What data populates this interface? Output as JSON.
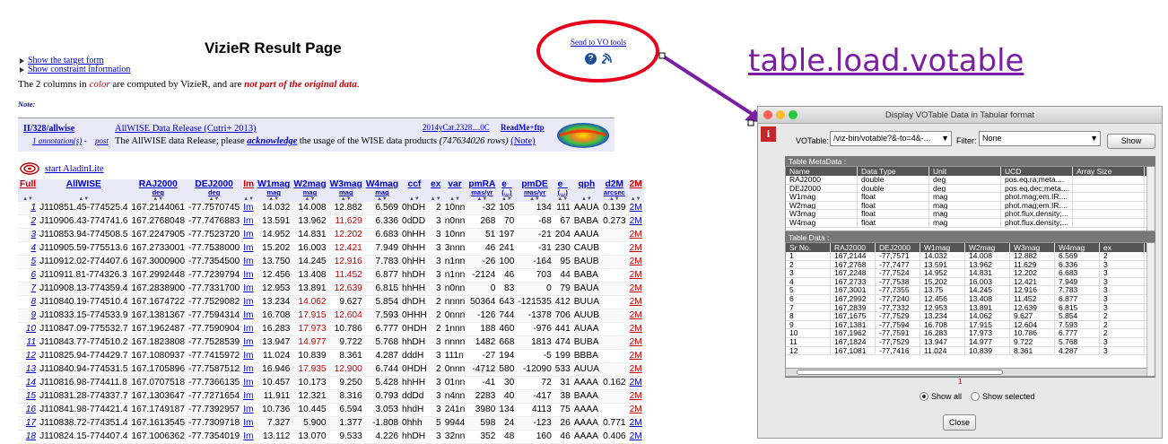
{
  "page": {
    "title": "VizieR Result Page",
    "links": [
      "Show the target form",
      "Show constraint information"
    ],
    "columns_note_prefix": "The 2 columns in ",
    "columns_note_color": "color",
    "columns_note_mid": " are computed by VizieR, and are ",
    "columns_note_not": "not part of the original data",
    "columns_note_suffix": ".",
    "note_label": "Note:",
    "send_vo": "Send to VO tools",
    "aladin": "start AladinLite"
  },
  "catalog": {
    "id": "II/328/allwise",
    "annotation": "1 annotation(s)",
    "annotation_sep": " - ",
    "post": "post",
    "name": "AllWISE Data Release (Cutri+ 2013)",
    "desc_prefix": "The AllWISE data Release; please ",
    "desc_ack": "acknowledge",
    "desc_mid": " the usage of the WISE data products ",
    "desc_rows": "(747634026 rows)",
    "desc_note": "(Note)",
    "ref": "2014yCat.2328....0C",
    "readme": "ReadMe+ftp"
  },
  "results": {
    "headers": [
      {
        "label": "Full",
        "unit": "",
        "red": true
      },
      {
        "label": "AllWISE",
        "unit": "",
        "red": false
      },
      {
        "label": "RAJ2000",
        "unit": "deg",
        "red": false
      },
      {
        "label": "DEJ2000",
        "unit": "deg",
        "red": false
      },
      {
        "label": "Im",
        "unit": "",
        "red": true
      },
      {
        "label": "W1mag",
        "unit": "mag",
        "red": false
      },
      {
        "label": "W2mag",
        "unit": "mag",
        "red": false
      },
      {
        "label": "W3mag",
        "unit": "mag",
        "red": false
      },
      {
        "label": "W4mag",
        "unit": "mag",
        "red": false
      },
      {
        "label": "ccf",
        "unit": "",
        "red": false
      },
      {
        "label": "ex",
        "unit": "",
        "red": false
      },
      {
        "label": "var",
        "unit": "",
        "red": false
      },
      {
        "label": "pmRA",
        "unit": "mas/yr",
        "red": false
      },
      {
        "label": "e_",
        "unit": "(...)",
        "red": false
      },
      {
        "label": "pmDE",
        "unit": "mas/yr",
        "red": false
      },
      {
        "label": "e_",
        "unit": "(...)",
        "red": false
      },
      {
        "label": "qph",
        "unit": "",
        "red": false
      },
      {
        "label": "d2M",
        "unit": "arcsec",
        "red": false
      },
      {
        "label": "2M",
        "unit": "",
        "red": true
      }
    ],
    "sort_glyph": "▲▼",
    "rows": [
      [
        "1",
        "J110851.45-774525.4",
        "167.2144061",
        "-77.7570745",
        "Im",
        "14.032",
        "14.008",
        "12.882",
        "6.569",
        "0hDH",
        "2",
        "10nn",
        "-32",
        "105",
        "134",
        "111",
        "AAUA",
        "0.139",
        "2M"
      ],
      [
        "2",
        "J110906.43-774741.6",
        "167.2768048",
        "-77.7476883",
        "Im",
        "13.591",
        "13.962",
        "11.629",
        "6.336",
        "0dDD",
        "3",
        "n0nn",
        "268",
        "70",
        "-68",
        "67",
        "BABA",
        "0.273",
        "2M"
      ],
      [
        "3",
        "J110853.94-774508.5",
        "167.2247905",
        "-77.7523720",
        "Im",
        "14.952",
        "14.831",
        "12.202",
        "6.683",
        "0hHH",
        "3",
        "10nn",
        "51",
        "197",
        "-21",
        "204",
        "AAUA",
        "",
        "2M"
      ],
      [
        "4",
        "J110905.59-775513.6",
        "167.2733001",
        "-77.7538000",
        "Im",
        "15.202",
        "16.003",
        "12.421",
        "7.949",
        "0hHH",
        "3",
        "3nnn",
        "46",
        "241",
        "-31",
        "230",
        "CAUB",
        "",
        "2M"
      ],
      [
        "5",
        "J110912.02-774407.6",
        "167.3000900",
        "-77.7354500",
        "Im",
        "13.750",
        "14.245",
        "12.916",
        "7.783",
        "0hHH",
        "3",
        "n1nn",
        "-26",
        "100",
        "-164",
        "95",
        "BAUB",
        "",
        "2M"
      ],
      [
        "6",
        "J110911.81-774326.3",
        "167.2992448",
        "-77.7239794",
        "Im",
        "12.456",
        "13.408",
        "11.452",
        "6.877",
        "hhDH",
        "3",
        "n1nn",
        "-2124",
        "46",
        "703",
        "44",
        "BABA",
        "",
        "2M"
      ],
      [
        "7",
        "J110908.13-774359.4",
        "167.2838900",
        "-77.7331700",
        "Im",
        "12.953",
        "13.891",
        "12.639",
        "6.815",
        "hhHH",
        "3",
        "n0nn",
        "0",
        "83",
        "0",
        "79",
        "BAUA",
        "",
        "2M"
      ],
      [
        "8",
        "J110840.19-774510.4",
        "167.1674722",
        "-77.7529082",
        "Im",
        "13.234",
        "14.062",
        "9.627",
        "5.854",
        "dhDH",
        "2",
        "nnnn",
        "50364",
        "643",
        "-121535",
        "412",
        "BUUA",
        "",
        "2M"
      ],
      [
        "9",
        "J110833.15-774533.9",
        "167.1381367",
        "-77.7594314",
        "Im",
        "16.708",
        "17.915",
        "12.604",
        "7.593",
        "0HHH",
        "2",
        "0nnn",
        "-126",
        "744",
        "-1378",
        "706",
        "AUUB",
        "",
        "2M"
      ],
      [
        "10",
        "J110847.09-775532.7",
        "167.1962487",
        "-77.7590904",
        "Im",
        "16.283",
        "17.973",
        "10.786",
        "6.777",
        "0HDH",
        "2",
        "1nnn",
        "188",
        "460",
        "-976",
        "441",
        "AUAA",
        "",
        "2M"
      ],
      [
        "11",
        "J110843.77-774510.2",
        "167.1823808",
        "-77.7528539",
        "Im",
        "13.947",
        "14.977",
        "9.722",
        "5.768",
        "hhDH",
        "3",
        "nnnn",
        "1482",
        "668",
        "1813",
        "474",
        "BUBA",
        "",
        "2M"
      ],
      [
        "12",
        "J110825.94-774429.7",
        "167.1080937",
        "-77.7415972",
        "Im",
        "11.024",
        "10.839",
        "8.361",
        "4.287",
        "dddH",
        "3",
        "111n",
        "-27",
        "194",
        "-5",
        "199",
        "BBBA",
        "",
        "2M"
      ],
      [
        "13",
        "J110840.94-774531.5",
        "167.1705896",
        "-77.7587512",
        "Im",
        "16.946",
        "17.935",
        "12.900",
        "6.744",
        "0HDH",
        "2",
        "0nnn",
        "-4712",
        "580",
        "-12090",
        "533",
        "AUUA",
        "",
        "2M"
      ],
      [
        "14",
        "J110816.98-774411.8",
        "167.0707518",
        "-77.7366135",
        "Im",
        "10.457",
        "10.173",
        "9.250",
        "5.428",
        "hhHH",
        "3",
        "01nn",
        "-41",
        "30",
        "72",
        "31",
        "AAAA",
        "0.162",
        "2M"
      ],
      [
        "15",
        "J110831.28-774337.7",
        "167.1303647",
        "-77.7271654",
        "Im",
        "11.911",
        "12.321",
        "8.316",
        "0.793",
        "ddDd",
        "3",
        "n4nn",
        "2283",
        "40",
        "-417",
        "38",
        "BAAA",
        "",
        "2M"
      ],
      [
        "16",
        "J110841.98-774421.4",
        "167.1749187",
        "-77.7392957",
        "Im",
        "10.736",
        "10.445",
        "6.594",
        "3.053",
        "hhdH",
        "3",
        "241n",
        "3980",
        "134",
        "4113",
        "75",
        "AAAA",
        "",
        "2M"
      ],
      [
        "17",
        "J110838.72-774351.4",
        "167.1613545",
        "-77.7309718",
        "Im",
        "7.327",
        "5.900",
        "1.377",
        "-1.808",
        "0hhh",
        "5",
        "9944",
        "598",
        "24",
        "-123",
        "26",
        "AAAA",
        "0.771",
        "2M"
      ],
      [
        "18",
        "J110824.15-774407.4",
        "167.1006362",
        "-77.7354019",
        "Im",
        "13.112",
        "13.070",
        "9.533",
        "4.226",
        "hhDH",
        "3",
        "32nn",
        "352",
        "48",
        "160",
        "46",
        "AAAA",
        "0.406",
        "2M"
      ]
    ]
  },
  "annotation": {
    "command": "table.load.votable"
  },
  "window": {
    "title": "Display VOTable Data in Tabular format",
    "info_icon": "i",
    "votable_label": "VOTable:",
    "votable_value": "/viz-bin/votable?&-to=4&-...",
    "filter_label": "Filter:",
    "filter_value": "None",
    "show_button": "Show",
    "meta_title": "Table MetaData :",
    "meta_headers": [
      "Name",
      "Data Type",
      "Unit",
      "UCD",
      "Array Size"
    ],
    "meta_rows": [
      [
        "RAJ2000",
        "double",
        "deg",
        "pos.eq.ra;meta....",
        ""
      ],
      [
        "DEJ2000",
        "double",
        "deg",
        "pos.eq.dec;meta....",
        ""
      ],
      [
        "W1mag",
        "float",
        "mag",
        "phot.mag;em.IR....",
        ""
      ],
      [
        "W2mag",
        "float",
        "mag",
        "phot.mag;em.IR....",
        ""
      ],
      [
        "W3mag",
        "float",
        "mag",
        "phot.flux.density;...",
        ""
      ],
      [
        "W4mag",
        "float",
        "mag",
        "phot.flux.density;...",
        ""
      ]
    ],
    "data_title": "Table Data :",
    "data_headers": [
      "Sr No.",
      "RAJ2000",
      "DEJ2000",
      "W1mag",
      "W2mag",
      "W3mag",
      "W4mag",
      "ex"
    ],
    "data_rows": [
      [
        "1",
        "167,2144",
        "-77,7571",
        "14.032",
        "14.008",
        "12.882",
        "6.569",
        "2"
      ],
      [
        "2",
        "167,2768",
        "-77,7477",
        "13.591",
        "13.962",
        "11.629",
        "6.336",
        "3"
      ],
      [
        "3",
        "167,2248",
        "-77,7524",
        "14.952",
        "14.831",
        "12.202",
        "6.683",
        "3"
      ],
      [
        "4",
        "167,2733",
        "-77,7538",
        "15.202",
        "16.003",
        "12.421",
        "7.949",
        "3"
      ],
      [
        "5",
        "167,3001",
        "-77,7355",
        "13.75",
        "14.245",
        "12.916",
        "7.783",
        "3"
      ],
      [
        "6",
        "167,2992",
        "-77,7240",
        "12.456",
        "13.408",
        "11.452",
        "6.877",
        "3"
      ],
      [
        "7",
        "167,2839",
        "-77,7332",
        "12.953",
        "13.891",
        "12.639",
        "6.815",
        "3"
      ],
      [
        "8",
        "167,1675",
        "-77,7529",
        "13.234",
        "14.062",
        "9.627",
        "5.854",
        "2"
      ],
      [
        "9",
        "167,1381",
        "-77,7594",
        "16.708",
        "17.915",
        "12.604",
        "7.593",
        "2"
      ],
      [
        "10",
        "167,1962",
        "-77,7591",
        "16.283",
        "17.973",
        "10.786",
        "6.777",
        "2"
      ],
      [
        "11",
        "167,1824",
        "-77,7529",
        "13.947",
        "14.977",
        "9.722",
        "5.768",
        "3"
      ],
      [
        "12",
        "167,1081",
        "-77,7416",
        "11.024",
        "10.839",
        "8.361",
        "4.287",
        "3"
      ]
    ],
    "page_indicator": "1",
    "show_all": "Show all",
    "show_selected": "Show selected",
    "close_button": "Close"
  },
  "colors": {
    "link": "#0000cc",
    "computed": "#cc0000",
    "ring": "#e6001c",
    "arrow": "#7b1fa2"
  }
}
